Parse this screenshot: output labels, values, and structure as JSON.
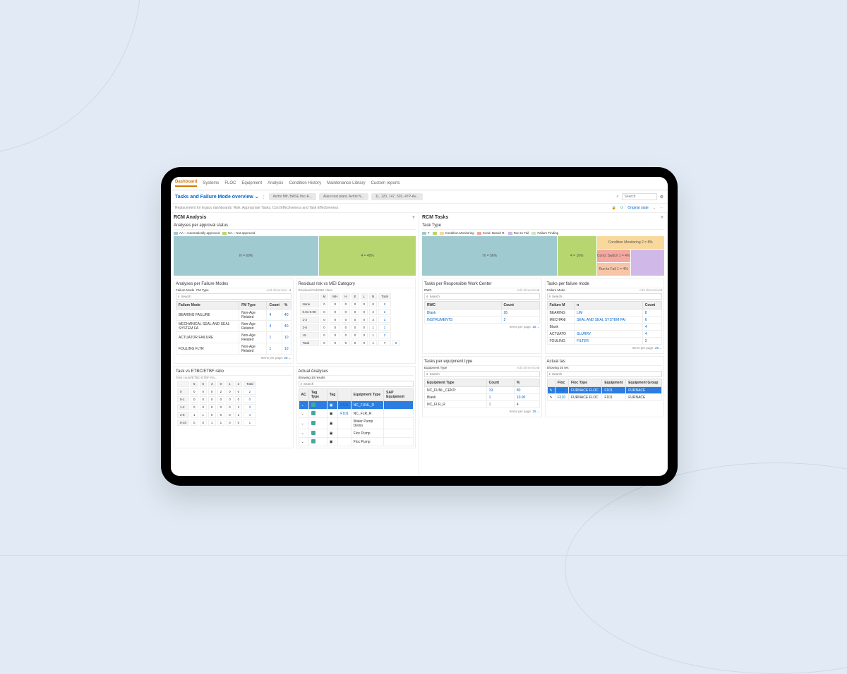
{
  "nav": [
    "Dashboard",
    "Systems",
    "FLOC",
    "Equipment",
    "Analysis",
    "Condition History",
    "Maintenance Library",
    "Custom reports"
  ],
  "activeNav": 0,
  "crumbTitle": "Tasks and Failure Mode overview",
  "crumbs": [
    "Avrtni Mfr, BASE floc-A...",
    "Alare test plant, Avrtni N...",
    "11, 120, 147, 503, 47P-Av..."
  ],
  "searchPlaceholder": "Search",
  "subtitle": "Replacement for legacy dashboards: Risk, Appropriate Tasks, Cost Effectiveness and Task Effectiveness",
  "stateLabel": "Original state",
  "left": {
    "title": "RCM Analysis",
    "approvalTitle": "Analyses per approval status",
    "approvalLegend": [
      {
        "label": "AA – Automatically approved",
        "color": "#9fcad0"
      },
      {
        "label": "NA – Not approved",
        "color": "#b8d66f"
      }
    ],
    "chart_data": {
      "type": "treemap",
      "title": "Analyses per approval status",
      "series": [
        {
          "name": "AA",
          "value": 60,
          "color": "#9fcad0",
          "label": "N = 60%"
        },
        {
          "name": "NA",
          "value": 40,
          "color": "#b8d66f",
          "label": "4 = 40%"
        }
      ]
    },
    "failureModesTitle": "Analyses per Failure Modes",
    "failureFilters": [
      "Failure Mode",
      "FM Type"
    ],
    "addDim": "Add dimension",
    "failureHeaders": [
      "Failure Mode",
      "FM Type",
      "Count",
      "%"
    ],
    "failureRows": [
      [
        "BEARING FAILURE",
        "Non-Age Related",
        "4",
        "40"
      ],
      [
        "MECHANICAL SEAL AND SEAL SYSTEM FA",
        "Non-Age Related",
        "4",
        "40"
      ],
      [
        "ACTUATOR FAILURE",
        "Non-Age Related",
        "1",
        "10"
      ],
      [
        "FOULING FLTR",
        "Non-Age Related",
        "1",
        "10"
      ]
    ],
    "itemsPerPage": "Items per page:",
    "pageSize": "25",
    "residualTitle": "Residual risk vs MEI Category",
    "residualAxis": "Residual Risk/MEI class",
    "matrixCols": [
      "M",
      "MH",
      "H",
      "E",
      "L",
      "N",
      "Total"
    ],
    "matrixRows": [
      {
        "label": "None",
        "v": [
          "0",
          "0",
          "0",
          "0",
          "0",
          "0",
          "0"
        ]
      },
      {
        "label": "0.01-0.99",
        "v": [
          "0",
          "0",
          "0",
          "0",
          "0",
          "2",
          "2"
        ]
      },
      {
        "label": "1-2",
        "v": [
          "0",
          "0",
          "0",
          "0",
          "0",
          "3",
          "3"
        ]
      },
      {
        "label": "2-5",
        "v": [
          "0",
          "0",
          "0",
          "0",
          "0",
          "1",
          "1"
        ]
      },
      {
        "label": ">5",
        "v": [
          "0",
          "0",
          "0",
          "0",
          "0",
          "1",
          "2"
        ]
      },
      {
        "label": "Total",
        "v": [
          "0",
          "0",
          "0",
          "0",
          "0",
          "1",
          "7",
          "8"
        ]
      }
    ],
    "ratioTitle": "Task vs ETBC/ETBF ratio",
    "ratioAxis": "Task count/ETBC-ETBF Ra...",
    "ratioCols": [
      "5",
      "6",
      "3",
      "0",
      "1",
      "2",
      "Total"
    ],
    "ratioRows": [
      {
        "label": "0",
        "v": [
          "0",
          "0",
          "0",
          "2",
          "0",
          "0",
          "2"
        ]
      },
      {
        "label": "0-1",
        "v": [
          "0",
          "0",
          "0",
          "0",
          "0",
          "0",
          "0"
        ]
      },
      {
        "label": "1-2",
        "v": [
          "0",
          "0",
          "0",
          "0",
          "0",
          "2",
          "3"
        ]
      },
      {
        "label": "2-5",
        "v": [
          "1",
          "1",
          "0",
          "0",
          "0",
          "2",
          "4"
        ]
      },
      {
        "label": "5-10",
        "v": [
          "0",
          "0",
          "1",
          "1",
          "0",
          "0",
          "1"
        ]
      }
    ],
    "actualTitle": "Actual Analyses",
    "showing": "Showing 10 results",
    "actualHeaders": [
      "AC",
      "Tag Type",
      "Tag",
      "",
      "Equipment Type",
      "SAP Equipment"
    ],
    "actualRows": [
      {
        "tag": "F101",
        "eq": "NC_FUNL_R",
        "hl": true
      },
      {
        "tag": "F101",
        "eq": "NC_FLR_R"
      },
      {
        "tag": "",
        "eq": "Water Pump Demo"
      },
      {
        "tag": "",
        "eq": "Floc Pump"
      },
      {
        "tag": "",
        "eq": "Floc Pump"
      }
    ]
  },
  "right": {
    "title": "RCM Tasks",
    "taskTypeTitle": "Task Type",
    "taskLegend": [
      {
        "label": "7",
        "color": "#9fcad0"
      },
      {
        "label": "",
        "color": "#b8d66f"
      },
      {
        "label": "Condition Monitoring",
        "color": "#f9d89b"
      },
      {
        "label": "Cond. Based R.",
        "color": "#f4a8a0"
      },
      {
        "label": "Run to Fail",
        "color": "#d0b8e8"
      },
      {
        "label": "Failure Finding",
        "color": "#c8e8c0"
      }
    ],
    "chart_data": {
      "type": "treemap",
      "title": "Task Type",
      "series": [
        {
          "name": "7",
          "value": 56,
          "color": "#9fcad0",
          "label": "7n = 56%"
        },
        {
          "name": "",
          "value": 16,
          "color": "#b8d66f",
          "label": "4 = 16%"
        },
        {
          "name": "Condition Monitoring",
          "value": 8,
          "color": "#f9d89b",
          "label": "Condition Monitoring 2 = 8%"
        },
        {
          "name": "Cond. Based",
          "value": 8,
          "color": "#f4a8a0",
          "label": "Cond. Switch 1 = 4%"
        },
        {
          "name": "Run to Fail",
          "value": 4,
          "color": "#f7c5a8",
          "label": "Run to Fail 1 = 4%"
        },
        {
          "name": "",
          "value": 8,
          "color": "#d0b8e8",
          "label": ""
        }
      ]
    },
    "rwcTitle": "Tasks per Responsible Work Center",
    "rwcLabel": "RWC",
    "rwcHeaders": [
      "RWC",
      "Count"
    ],
    "rwcRows": [
      [
        "Blank",
        "26"
      ],
      [
        "INSTRUMENTS",
        "2"
      ]
    ],
    "modeTitle": "failure mode",
    "tasksPerLabel": "Tasks per",
    "modeLabel": "Failure Mode",
    "modeHeaders": [
      "Failure M",
      "n",
      "Count"
    ],
    "modeRows": [
      [
        "BEARING",
        "LIM",
        "8"
      ],
      [
        "MECHANI",
        "SEAL AND SEAL SYSTEM FAI",
        "6"
      ],
      [
        "Blank",
        "",
        "4"
      ],
      [
        "ACTUATO",
        "SLURRY",
        "4"
      ],
      [
        "FOULING",
        "FILTER",
        "2"
      ]
    ],
    "eqTypeTitle": "Tasks per equipment type",
    "eqTypeLabel": "Equipment Type",
    "eqTypeHeaders": [
      "Equipment Type",
      "Count",
      "%"
    ],
    "eqTypeRows": [
      [
        "NC_FUNL_CENTr",
        "19",
        "80"
      ],
      [
        "Blank",
        "1",
        "10.00"
      ],
      [
        "NC_FLR_R",
        "1",
        "4"
      ]
    ],
    "actualTasksTitle": "Actual tas",
    "actualTasksHeaders": [
      "Floc",
      "Floc Type",
      "Equipment",
      "Equipment Group"
    ],
    "actualTasksRows": [
      [
        "F101",
        "FURNACE FLOC",
        "F101",
        "FURNACE",
        true
      ],
      [
        "F101",
        "FURNACE FLOC",
        "F101",
        "FURNACE"
      ]
    ],
    "showing25": "Showing 25 res"
  }
}
